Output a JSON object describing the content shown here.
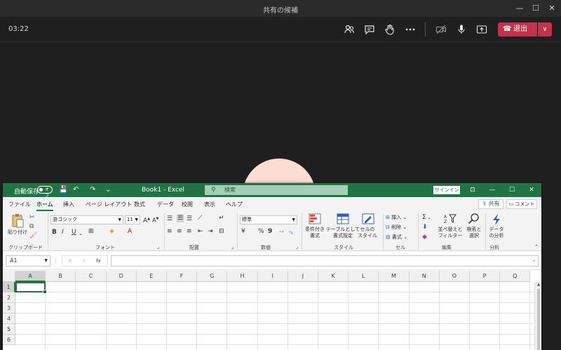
{
  "teams": {
    "window_title": "共有の候補",
    "window_controls": [
      "—",
      "☐",
      "✕"
    ],
    "timer": "03:22",
    "leave_label": "退出",
    "leave_dropdown": "∨",
    "colors": {
      "leave": "#c4314b",
      "avatar": "#fcdcd3"
    }
  },
  "excel": {
    "autosave_label": "自動保存",
    "autosave_state": "オフ",
    "qat": [
      "💾",
      "↶",
      "↷",
      "⌄"
    ],
    "book_title": "Book1  -  Excel",
    "search_placeholder": "検索",
    "signin_label": "サインイン",
    "window_controls": [
      "⊡",
      "—",
      "☐",
      "✕"
    ],
    "tabs": [
      "ファイル",
      "ホーム",
      "挿入",
      "ページ レイアウト",
      "数式",
      "データ",
      "校閲",
      "表示",
      "ヘルプ"
    ],
    "active_tab": "ホーム",
    "share_label": "共有",
    "comment_label": "コメント",
    "ribbon": {
      "clipboard": {
        "paste_label": "貼り付け",
        "group": "クリップボード"
      },
      "font": {
        "font_name": "游ゴシック",
        "font_size": "11",
        "bold": "B",
        "italic": "I",
        "underline": "U",
        "group": "フォント"
      },
      "alignment": {
        "group": "配置"
      },
      "number": {
        "format": "標準",
        "percent": "%",
        "comma": "9",
        "group": "数値"
      },
      "styles": {
        "conditional": [
          "条件付き",
          "書式"
        ],
        "table": [
          "テーブルとして",
          "書式設定"
        ],
        "cell_styles": [
          "セルの",
          "スタイル"
        ],
        "group": "スタイル"
      },
      "cells": {
        "insert": "挿入",
        "delete": "削除",
        "format": "書式",
        "group": "セル"
      },
      "editing": {
        "sum": "Σ",
        "sort_filter": [
          "並べ替えと",
          "フィルター"
        ],
        "find_select": [
          "検索と",
          "選択"
        ],
        "group": "編集"
      },
      "analysis": {
        "analyze": [
          "データ",
          "の分析"
        ],
        "group": "分析"
      }
    },
    "namebox": "A1",
    "fx": "fx",
    "columns": [
      "A",
      "B",
      "C",
      "D",
      "E",
      "F",
      "G",
      "H",
      "I",
      "J",
      "K",
      "L",
      "M",
      "N",
      "O",
      "P",
      "Q"
    ],
    "rows": [
      "1",
      "2",
      "3",
      "4",
      "5",
      "6"
    ],
    "colors": {
      "green": "#217346"
    }
  }
}
